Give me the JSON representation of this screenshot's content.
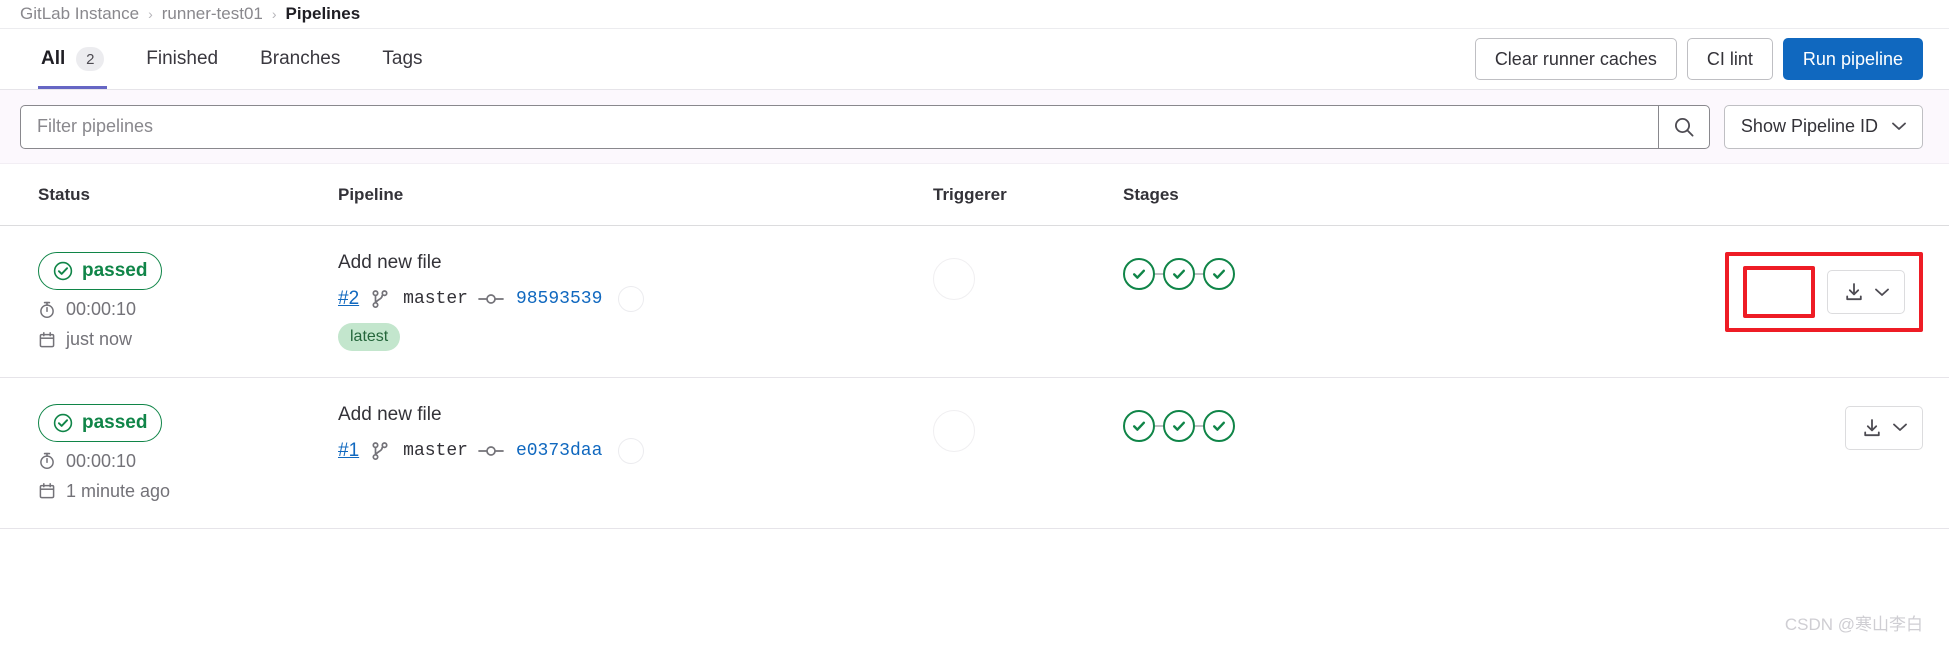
{
  "breadcrumb": {
    "items": [
      "GitLab Instance",
      "runner-test01"
    ],
    "separator": "›",
    "current": "Pipelines"
  },
  "tabs": [
    {
      "label": "All",
      "badge": "2",
      "active": true
    },
    {
      "label": "Finished",
      "badge": "",
      "active": false
    },
    {
      "label": "Branches",
      "badge": "",
      "active": false
    },
    {
      "label": "Tags",
      "badge": "",
      "active": false
    }
  ],
  "header_actions": {
    "clear_caches_label": "Clear runner caches",
    "ci_lint_label": "CI lint",
    "run_pipeline_label": "Run pipeline"
  },
  "filter_bar": {
    "search_placeholder": "Filter pipelines",
    "search_value": "",
    "search_icon": "search-icon",
    "pipeline_id_label": "Show Pipeline ID",
    "chevron": "⌄"
  },
  "table": {
    "columns": [
      "Status",
      "Pipeline",
      "Triggerer",
      "Stages"
    ],
    "rows": [
      {
        "status": {
          "badge": "passed",
          "duration": "00:00:10",
          "timestamp": "just now",
          "duration_icon": "stopwatch-icon",
          "time_icon": "calendar-icon"
        },
        "pipeline": {
          "title": "Add new file",
          "id": "#2",
          "branch": "master",
          "commit": "98593539",
          "tag": "latest",
          "branch_icon": "branch-icon",
          "commit_icon": "commit-icon"
        },
        "triggerer": "",
        "stages": [
          "passed",
          "passed",
          "passed"
        ],
        "actions": {
          "download_icon": "download-icon",
          "chevron": "⌄",
          "annotated": true
        }
      },
      {
        "status": {
          "badge": "passed",
          "duration": "00:00:10",
          "timestamp": "1 minute ago",
          "duration_icon": "stopwatch-icon",
          "time_icon": "calendar-icon"
        },
        "pipeline": {
          "title": "Add new file",
          "id": "#1",
          "branch": "master",
          "commit": "e0373daa",
          "tag": "",
          "branch_icon": "branch-icon",
          "commit_icon": "commit-icon"
        },
        "triggerer": "",
        "stages": [
          "passed",
          "passed",
          "passed"
        ],
        "actions": {
          "download_icon": "download-icon",
          "chevron": "⌄",
          "annotated": false
        }
      }
    ]
  },
  "watermark": "CSDN @寒山李白",
  "colors": {
    "primary": "#1068bf",
    "success": "#108548",
    "tab_active": "#6666c4",
    "annotation": "#ee1c25",
    "badge_bg": "#c3e6cd",
    "filter_bg": "#fcf8fd"
  }
}
